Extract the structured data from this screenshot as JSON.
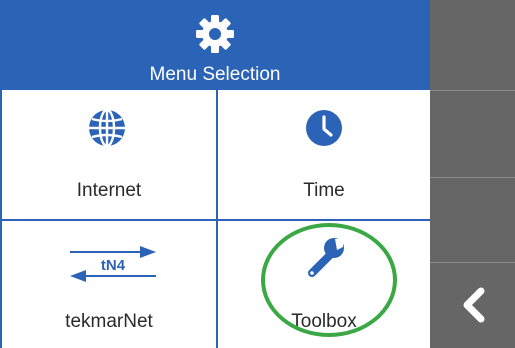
{
  "header": {
    "title": "Menu Selection",
    "icon": "gear-icon",
    "background": "#2b63b6"
  },
  "menu": {
    "items": [
      {
        "label": "Internet",
        "icon": "globe-icon"
      },
      {
        "label": "Time",
        "icon": "clock-icon"
      },
      {
        "label": "tekmarNet",
        "icon": "tekmarnet-icon",
        "icon_text": "tN4"
      },
      {
        "label": "Toolbox",
        "icon": "wrench-icon"
      }
    ]
  },
  "sidebar": {
    "back_icon": "chevron-left-icon"
  },
  "colors": {
    "accent": "#2b63b6",
    "sidebar": "#666666",
    "highlight": "#3aa845"
  }
}
